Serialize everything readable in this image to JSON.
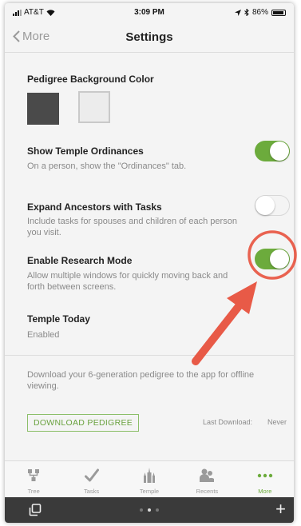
{
  "status_bar": {
    "carrier": "AT&T",
    "time": "3:09 PM",
    "battery": "86%"
  },
  "nav": {
    "back_label": "More",
    "title": "Settings"
  },
  "pedigree_bg": {
    "label": "Pedigree Background Color",
    "swatches": [
      "#4a4a4a",
      "#ececec"
    ]
  },
  "settings": [
    {
      "label": "Show Temple Ordinances",
      "description": "On a person, show the \"Ordinances\" tab.",
      "enabled": true
    },
    {
      "label": "Expand Ancestors with Tasks",
      "description": "Include tasks for spouses and children of each person you visit.",
      "enabled": false
    },
    {
      "label": "Enable Research Mode",
      "description": "Allow multiple windows for quickly moving back and forth between screens.",
      "enabled": true
    }
  ],
  "temple_today": {
    "label": "Temple Today",
    "value": "Enabled"
  },
  "download": {
    "description": "Download your 6-generation pedigree to the app for offline viewing.",
    "button_label": "DOWNLOAD PEDIGREE",
    "last_download_label": "Last Download:",
    "last_download_value": "Never"
  },
  "tabs": [
    {
      "label": "Tree",
      "icon": "tree-icon"
    },
    {
      "label": "Tasks",
      "icon": "checkmark-icon"
    },
    {
      "label": "Temple",
      "icon": "temple-icon"
    },
    {
      "label": "Recents",
      "icon": "people-icon"
    },
    {
      "label": "More",
      "icon": "more-dots-icon",
      "active": true
    }
  ],
  "colors": {
    "accent_green": "#6cab3c",
    "annotation_red": "#e8523e"
  }
}
